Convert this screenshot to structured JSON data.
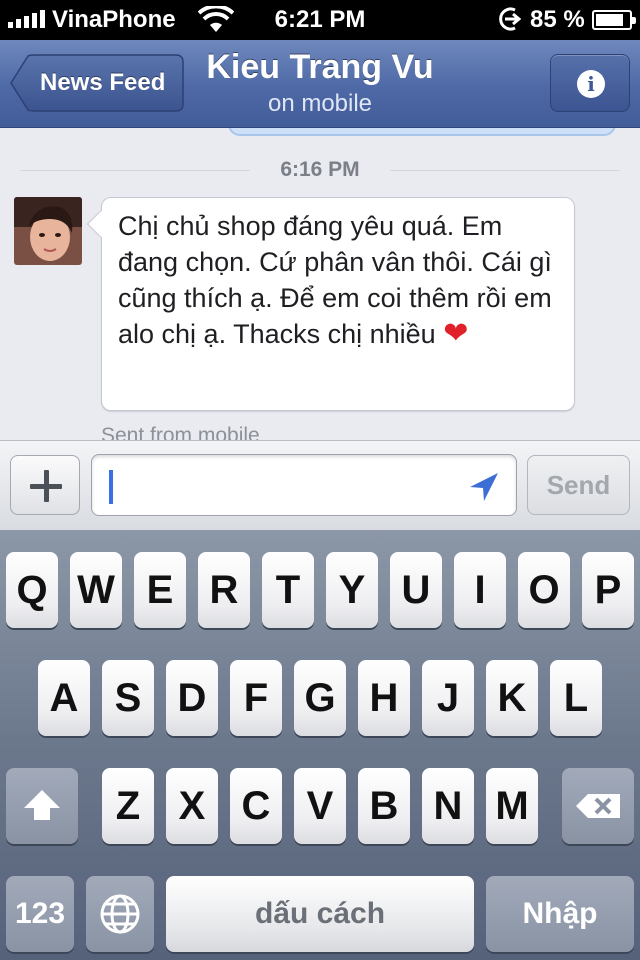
{
  "status_bar": {
    "carrier": "VinaPhone",
    "time": "6:21 PM",
    "battery_percent": "85 %",
    "battery_level": 0.85
  },
  "nav": {
    "back_label": "News Feed",
    "title": "Kieu Trang Vu",
    "subtitle": "on mobile"
  },
  "conversation": {
    "timestamp": "6:16 PM",
    "message_text": "Chị chủ shop đáng yêu quá. Em đang chọn. Cứ phân vân thôi. Cái gì cũng thích ạ. Để em coi thêm rồi em alo chị ạ. Thacks chị nhiều",
    "emoji": "❤",
    "sent_from": "Sent from mobile"
  },
  "composer": {
    "input_value": "",
    "send_label": "Send"
  },
  "keyboard": {
    "row1": [
      "Q",
      "W",
      "E",
      "R",
      "T",
      "Y",
      "U",
      "I",
      "O",
      "P"
    ],
    "row2": [
      "A",
      "S",
      "D",
      "F",
      "G",
      "H",
      "J",
      "K",
      "L"
    ],
    "row3": [
      "Z",
      "X",
      "C",
      "V",
      "B",
      "N",
      "M"
    ],
    "numbers_label": "123",
    "space_label": "dấu cách",
    "return_label": "Nhập"
  },
  "colors": {
    "nav_blue": "#4e69a6",
    "keyboard_bg": "#6b778b",
    "cursor_blue": "#3a6fe4",
    "heart_red": "#e0212a"
  }
}
